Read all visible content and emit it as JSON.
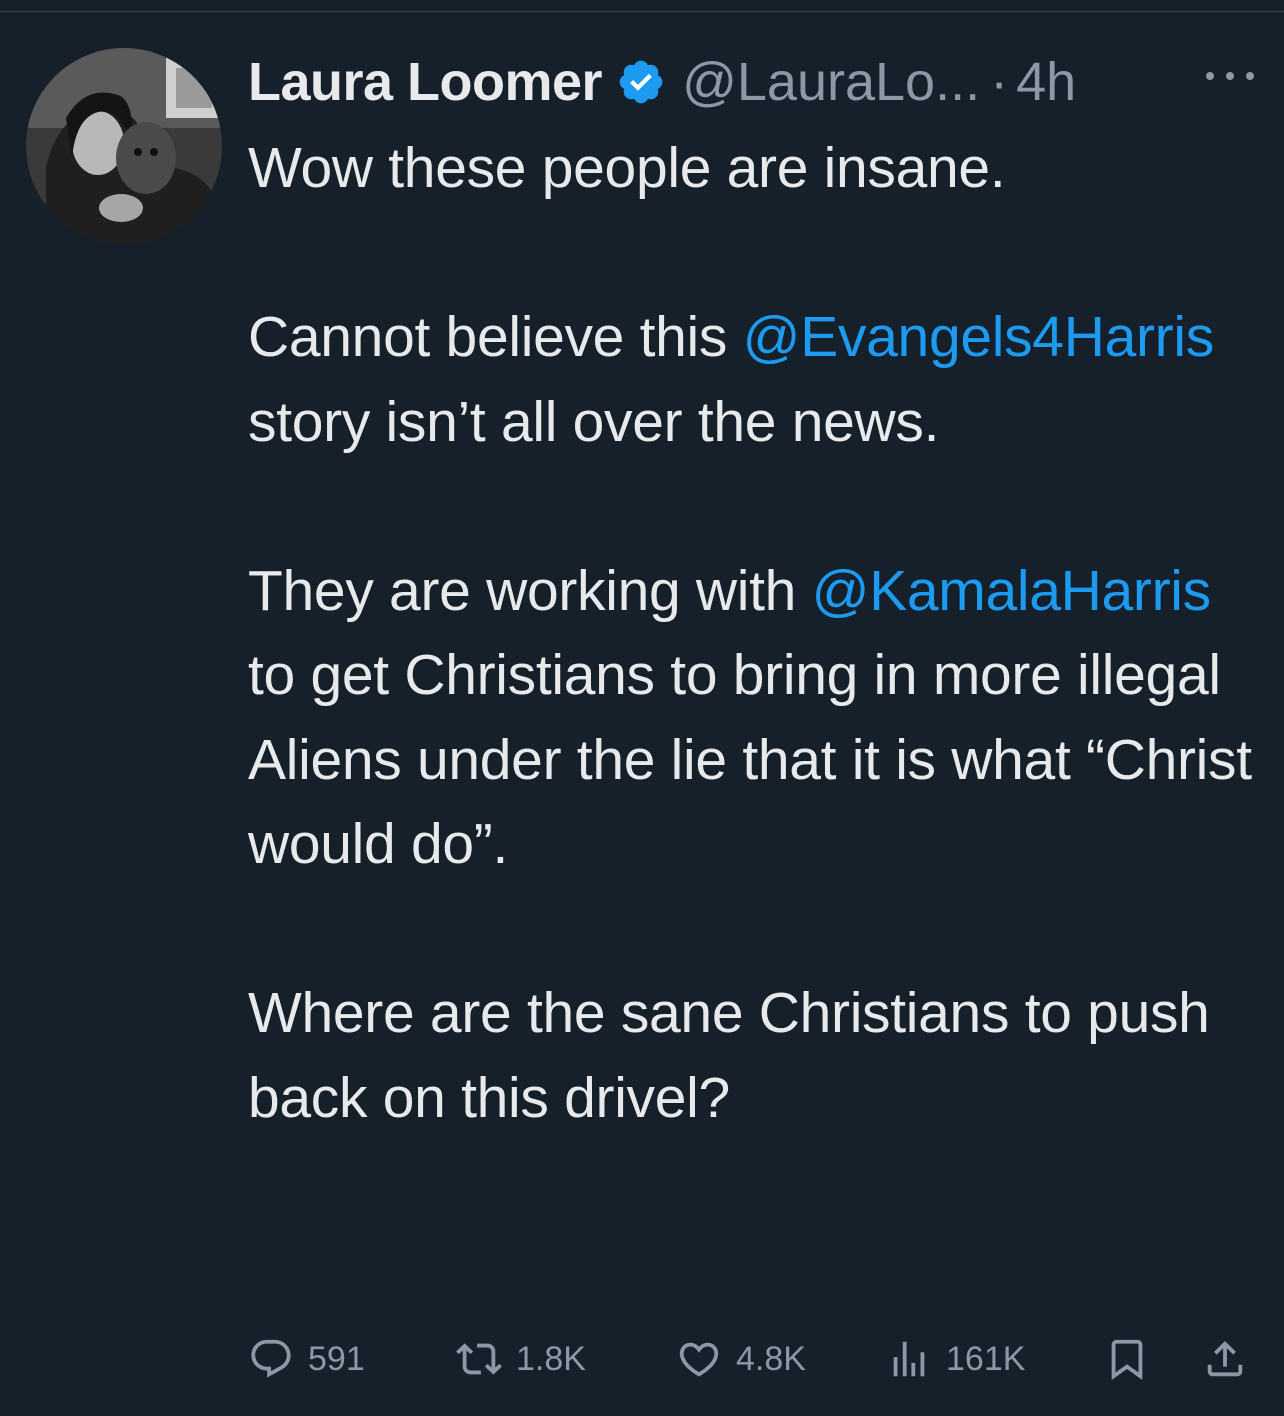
{
  "colors": {
    "background": "#15202b",
    "text": "#e7e9ea",
    "secondary": "#8b98a5",
    "accent": "#1d9bf0"
  },
  "tweet": {
    "author": {
      "display_name": "Laura Loomer",
      "handle": "@LauraLo...",
      "verified_icon": "verified-badge-icon"
    },
    "separator": "·",
    "time": "4h",
    "more_icon": "more-horizontal-icon",
    "body": {
      "p1": "Wow these people are insane.",
      "p2_pre": "Cannot believe this ",
      "p2_mention": "@Evangels4Harris",
      "p2_post": " story isn’t all over the news.",
      "p3_pre": "They are working with ",
      "p3_mention": "@KamalaHarris",
      "p3_post": " to get Christians to bring in more illegal Aliens under the lie that it is what “Christ would do”.",
      "p4": "Where are the sane Christians to push back on this drivel?"
    },
    "actions": {
      "reply": {
        "icon": "reply-icon",
        "count": "591"
      },
      "retweet": {
        "icon": "retweet-icon",
        "count": "1.8K"
      },
      "like": {
        "icon": "heart-icon",
        "count": "4.8K"
      },
      "views": {
        "icon": "views-icon",
        "count": "161K"
      },
      "bookmark": {
        "icon": "bookmark-icon"
      },
      "share": {
        "icon": "share-icon"
      }
    }
  }
}
